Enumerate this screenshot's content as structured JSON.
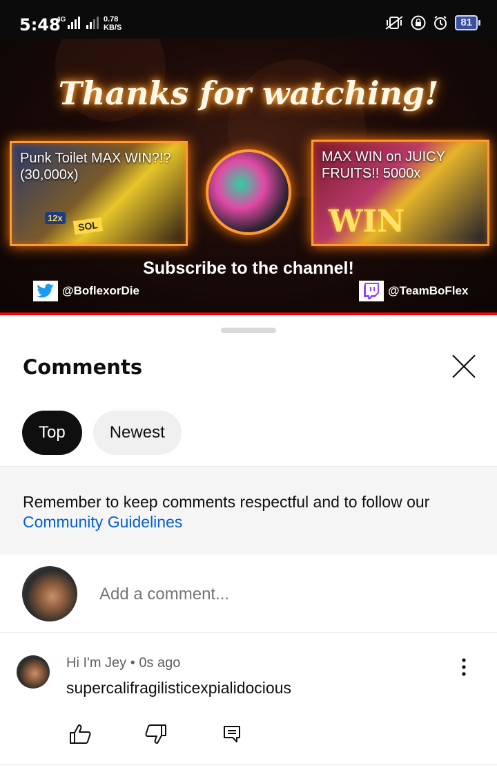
{
  "status_bar": {
    "time": "5:48",
    "network_type": "4G",
    "speed_value": "0.78",
    "speed_unit": "KB/S",
    "battery": "81"
  },
  "video": {
    "end_title": "Thanks for watching!",
    "left_card_title": "Punk Toilet MAX WIN?!? (30,000x)",
    "right_card_title": "MAX WIN on JUICY FRUITS!! 5000x",
    "subscribe_text": "Subscribe to the channel!",
    "twitter_handle": "@BoflexorDie",
    "twitch_handle": "@TeamBoFlex",
    "progress": 1.0,
    "progress_color": "#ff0000"
  },
  "comments_panel": {
    "title": "Comments",
    "tabs": [
      {
        "label": "Top",
        "active": true
      },
      {
        "label": "Newest",
        "active": false
      }
    ],
    "notice_text": "Remember to keep comments respectful and to follow our",
    "notice_link": "Community Guidelines",
    "add_comment_placeholder": "Add a comment...",
    "comments": [
      {
        "author": "Hi I'm Jey",
        "separator": "•",
        "time": "0s ago",
        "text": "supercalifragilisticexpialidocious"
      }
    ]
  },
  "colors": {
    "accent_link": "#065fd4",
    "chip_active_bg": "#0f0f0f",
    "chip_inactive_bg": "#f0f0f0",
    "notice_bg": "#f5f5f5"
  }
}
